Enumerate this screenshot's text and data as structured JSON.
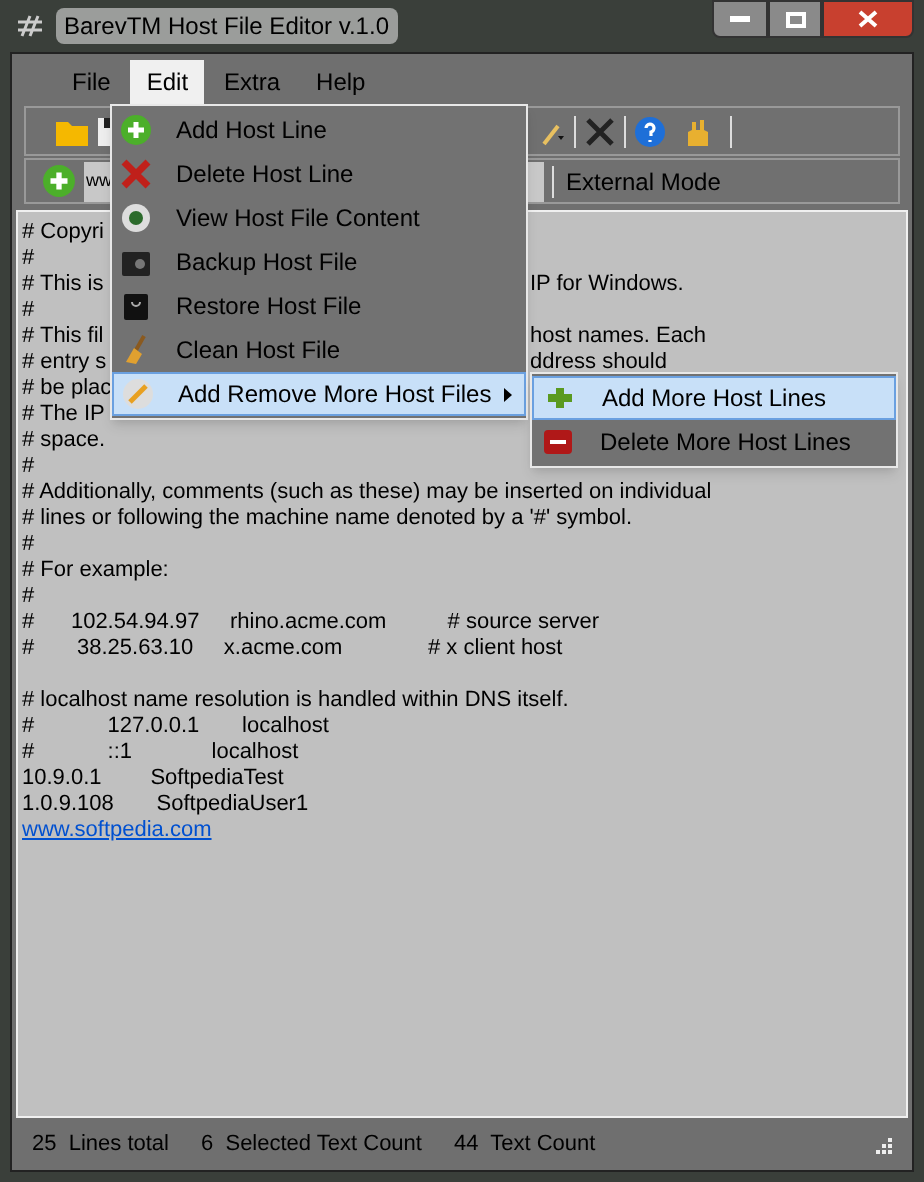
{
  "window": {
    "title": "BarevTM Host File Editor v.1.0"
  },
  "menu_bar": [
    {
      "label": "File",
      "selected": false
    },
    {
      "label": "Edit",
      "selected": true
    },
    {
      "label": "Extra",
      "selected": false
    },
    {
      "label": "Help",
      "selected": false
    }
  ],
  "address_field": {
    "value": "ww"
  },
  "mode_label": "External Mode",
  "editor_lines": [
    {
      "kind": "text",
      "text": "# Copyri"
    },
    {
      "kind": "text",
      "text": "#"
    },
    {
      "kind": "text",
      "text": "# This is",
      "tail": "IP for Windows."
    },
    {
      "kind": "text",
      "text": "#"
    },
    {
      "kind": "text",
      "text": "# This fil",
      "tail": "host names. Each"
    },
    {
      "kind": "text",
      "text": "# entry s",
      "tail": "ddress should"
    },
    {
      "kind": "text",
      "text": "# be plac"
    },
    {
      "kind": "text",
      "text": "# The IP"
    },
    {
      "kind": "text",
      "text": "# space."
    },
    {
      "kind": "text",
      "text": "#"
    },
    {
      "kind": "text",
      "text": "# Additionally, comments (such as these) may be inserted on individual"
    },
    {
      "kind": "text",
      "text": "# lines or following the machine name denoted by a '#' symbol."
    },
    {
      "kind": "text",
      "text": "#"
    },
    {
      "kind": "text",
      "text": "# For example:"
    },
    {
      "kind": "text",
      "text": "#"
    },
    {
      "kind": "text",
      "text": "#      102.54.94.97     rhino.acme.com          # source server"
    },
    {
      "kind": "text",
      "text": "#       38.25.63.10     x.acme.com              # x client host"
    },
    {
      "kind": "blank"
    },
    {
      "kind": "text",
      "text": "# localhost name resolution is handled within DNS itself."
    },
    {
      "kind": "text",
      "text": "#            127.0.0.1       localhost"
    },
    {
      "kind": "text",
      "text": "#            ::1             localhost"
    },
    {
      "kind": "text",
      "text": "10.9.0.1        SoftpediaTest"
    },
    {
      "kind": "text",
      "text": "1.0.9.108       SoftpediaUser1"
    },
    {
      "kind": "link",
      "text": "www.softpedia.com"
    }
  ],
  "edit_menu": [
    {
      "label": "Add Host Line",
      "selected": false,
      "submenu": false
    },
    {
      "label": "Delete Host Line",
      "selected": false,
      "submenu": false
    },
    {
      "label": "View Host File Content",
      "selected": false,
      "submenu": false
    },
    {
      "label": "Backup Host File",
      "selected": false,
      "submenu": false
    },
    {
      "label": "Restore Host File",
      "selected": false,
      "submenu": false
    },
    {
      "label": "Clean Host File",
      "selected": false,
      "submenu": false
    },
    {
      "label": "Add Remove More Host Files",
      "selected": true,
      "submenu": true
    }
  ],
  "submenu": [
    {
      "label": "Add More Host Lines",
      "selected": true
    },
    {
      "label": "Delete More Host Lines",
      "selected": false
    }
  ],
  "status_bar": [
    "25  Lines total",
    "6  Selected Text Count",
    "44  Text Count"
  ]
}
